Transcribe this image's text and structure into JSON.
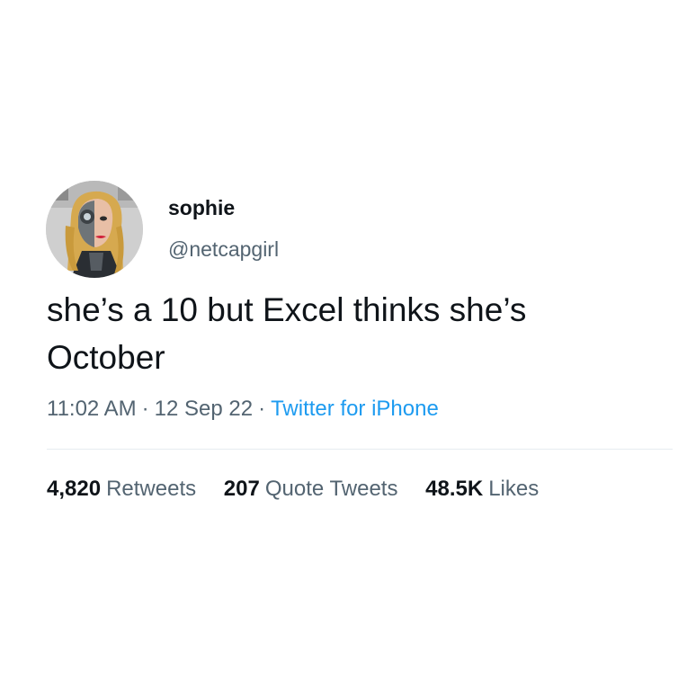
{
  "user": {
    "display_name": "sophie",
    "handle": "@netcapgirl",
    "avatar_icon": "avatar-image"
  },
  "tweet": {
    "text_lines": [
      "she’s a 10 but Excel thinks she’s",
      "October"
    ],
    "time": "11:02 AM",
    "separator": "·",
    "date": "12 Sep 22",
    "source": "Twitter for iPhone"
  },
  "stats": {
    "retweets_count": "4,820",
    "retweets_label": "Retweets",
    "quote_tweets_count": "207",
    "quote_tweets_label": "Quote Tweets",
    "likes_count": "48.5K",
    "likes_label": "Likes"
  },
  "colors": {
    "text_primary": "#0f1419",
    "text_secondary": "#536471",
    "link": "#1d9bf0",
    "divider": "#e6ecf0"
  }
}
